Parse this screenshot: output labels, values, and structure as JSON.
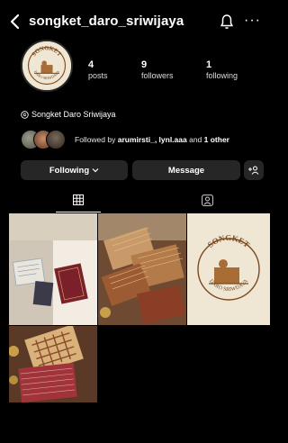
{
  "header": {
    "username": "songket_daro_sriwijaya",
    "back_icon": "chevron-left-icon",
    "bell_icon": "bell-icon",
    "more_label": "···"
  },
  "profile": {
    "logo_text_top": "SONGKET",
    "logo_text_bottom": "DARO SRIWIJAYA",
    "stats": {
      "posts": {
        "value": "4",
        "label": "posts"
      },
      "followers": {
        "value": "9",
        "label": "followers"
      },
      "following": {
        "value": "1",
        "label": "following"
      }
    },
    "full_name": "Songket Daro Sriwijaya",
    "followed_by_prefix": "Followed by ",
    "followed_by_names": "arumirsti_, lynl.aaa",
    "followed_by_suffix": " and ",
    "followed_by_other": "1 other"
  },
  "actions": {
    "following_label": "Following",
    "message_label": "Message"
  },
  "tabs": {
    "grid_icon": "grid-icon",
    "tagged_icon": "tagged-person-icon"
  },
  "posts": {
    "p3_text_top": "SONGKET",
    "p3_text_bottom": "DARO SRIWIJAYA"
  },
  "colors": {
    "background": "#000000",
    "button": "#262626",
    "cream": "#efe6d3",
    "brown": "#8a5a2b"
  }
}
